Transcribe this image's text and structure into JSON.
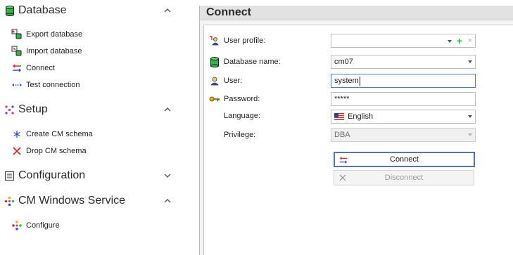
{
  "sidebar": {
    "groups": [
      {
        "title": "Database",
        "expanded": true,
        "items": [
          {
            "label": "Export database",
            "icon": "export-database-icon"
          },
          {
            "label": "Import database",
            "icon": "import-database-icon"
          },
          {
            "label": "Connect",
            "icon": "connect-arrows-icon"
          },
          {
            "label": "Test connection",
            "icon": "test-connection-icon"
          }
        ]
      },
      {
        "title": "Setup",
        "expanded": true,
        "items": [
          {
            "label": "Create CM schema",
            "icon": "snowflake-icon"
          },
          {
            "label": "Drop CM schema",
            "icon": "red-x-icon"
          }
        ]
      },
      {
        "title": "Configuration",
        "expanded": false,
        "items": []
      },
      {
        "title": "CM Windows Service",
        "expanded": true,
        "items": [
          {
            "label": "Configure",
            "icon": "configure-dots-icon"
          }
        ]
      }
    ]
  },
  "main": {
    "title": "Connect",
    "form": {
      "user_profile": {
        "label": "User profile:",
        "value": ""
      },
      "database_name": {
        "label": "Database name:",
        "value": "cm07"
      },
      "user": {
        "label": "User:",
        "value": "system"
      },
      "password": {
        "label": "Password:",
        "value": "*****"
      },
      "language": {
        "label": "Language:",
        "value": "English"
      },
      "privilege": {
        "label": "Privilege:",
        "value": "DBA"
      }
    },
    "buttons": {
      "connect": "Connect",
      "disconnect": "Disconnect"
    }
  },
  "colors": {
    "db_green": "#2fb64a",
    "accent_blue": "#5273b5",
    "connect_red": "#d92b2b",
    "connect_blue": "#2b4fd9"
  }
}
